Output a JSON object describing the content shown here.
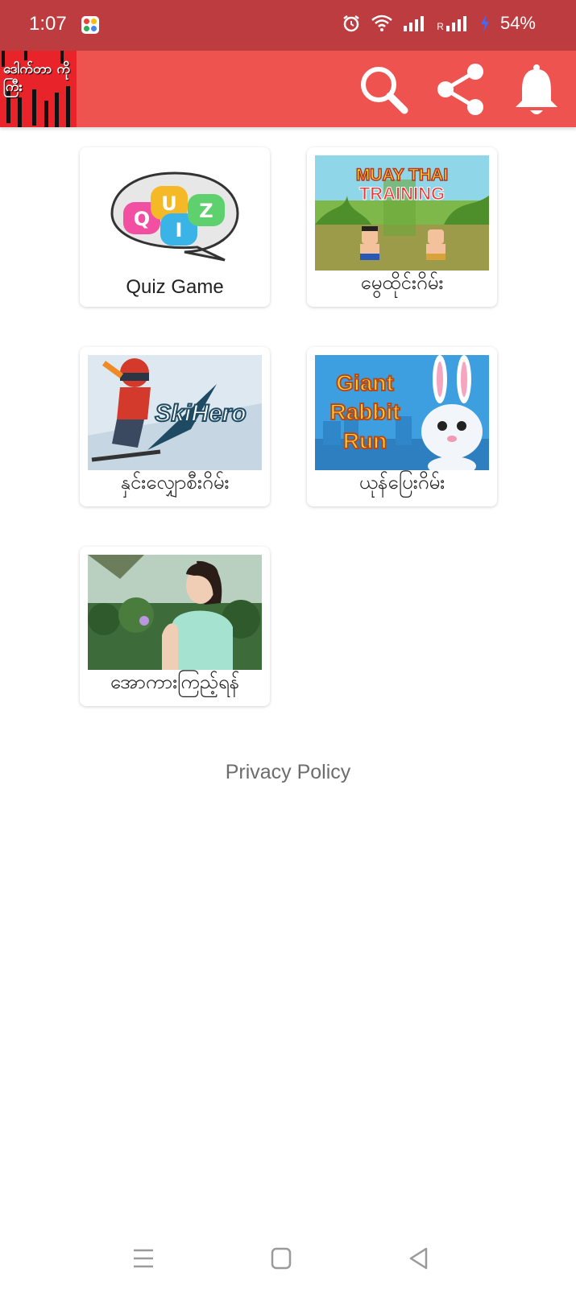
{
  "status_bar": {
    "time": "1:07",
    "battery": "54%",
    "roaming": "R"
  },
  "app_bar": {
    "logo_text": "ဒေါက်တာ ကိုကြီး",
    "icons": [
      "search-icon",
      "share-icon",
      "bell-icon"
    ]
  },
  "games": [
    {
      "label": "Quiz Game",
      "thumb_text": [
        "Q",
        "U",
        "I",
        "Z"
      ]
    },
    {
      "label": "မွေထိုင်းဂိမ်း",
      "thumb_text": [
        "MUAY THAI",
        "TRAINING"
      ]
    },
    {
      "label": "နှင်းလျှောစီးဂိမ်း",
      "thumb_text": [
        "SkiHero"
      ]
    },
    {
      "label": "ယုန်ပြေးဂိမ်း",
      "thumb_text": [
        "Giant",
        "Rabbit",
        "Run"
      ]
    },
    {
      "label": "အောကားကြည့်ရန်",
      "thumb_text": []
    }
  ],
  "footer": {
    "privacy_label": "Privacy Policy"
  },
  "colors": {
    "status_bar": "#bd3c3f",
    "app_bar": "#ef5350",
    "logo_bg": "#e8242a"
  }
}
